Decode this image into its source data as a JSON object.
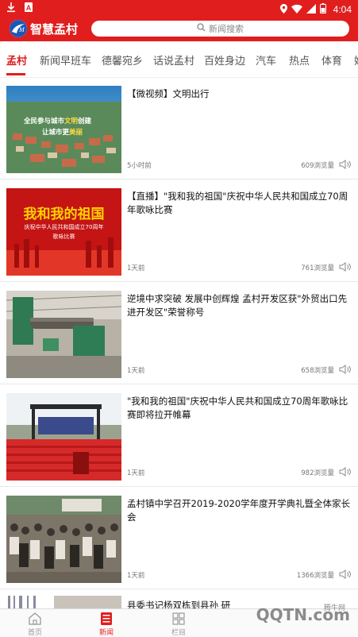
{
  "status_bar": {
    "time": "4:04"
  },
  "header": {
    "app_title": "智慧孟村",
    "search_placeholder": "新闻搜索"
  },
  "tabs": [
    "孟村",
    "新闻早班车",
    "德馨宛乡",
    "话说孟村",
    "百姓身边",
    "汽车",
    "热点",
    "体育",
    "娱"
  ],
  "news": [
    {
      "title": "【微视频】文明出行",
      "time": "5小时前",
      "views": "609浏览量",
      "thumb_caption_1": "全民参与城市",
      "thumb_caption_2": "文明",
      "thumb_caption_3": "创建",
      "thumb_caption_4": "让城市更",
      "thumb_caption_5": "美丽"
    },
    {
      "title": "【直播】\"我和我的祖国\"庆祝中华人民共和国成立70周年歌咏比赛",
      "time": "1天前",
      "views": "761浏览量",
      "thumb_caption_1": "我和我的祖国",
      "thumb_caption_2": "庆祝中华人民共和国成立70周年",
      "thumb_caption_3": "歌咏比赛"
    },
    {
      "title": "逆境中求突破 发展中创辉煌 孟村开发区获\"外贸出口先进开发区\"荣誉称号",
      "time": "1天前",
      "views": "658浏览量"
    },
    {
      "title": "\"我和我的祖国\"庆祝中华人民共和国成立70周年歌咏比赛即将拉开帷幕",
      "time": "1天前",
      "views": "982浏览量"
    },
    {
      "title": "孟村镇中学召开2019-2020学年度开学典礼暨全体家长会",
      "time": "1天前",
      "views": "1366浏览量"
    }
  ],
  "partial_news_title": "县委书记杨双栋到县孙  研",
  "bottom_nav": [
    {
      "label": "首页",
      "icon": "home-icon"
    },
    {
      "label": "新闻",
      "icon": "news-icon"
    },
    {
      "label": "栏目",
      "icon": "grid-icon"
    }
  ],
  "watermark": {
    "small": "腾牛网",
    "big": "QQTN.com"
  },
  "colors": {
    "brand": "#e01e1e",
    "text": "#111111",
    "muted": "#777777"
  }
}
